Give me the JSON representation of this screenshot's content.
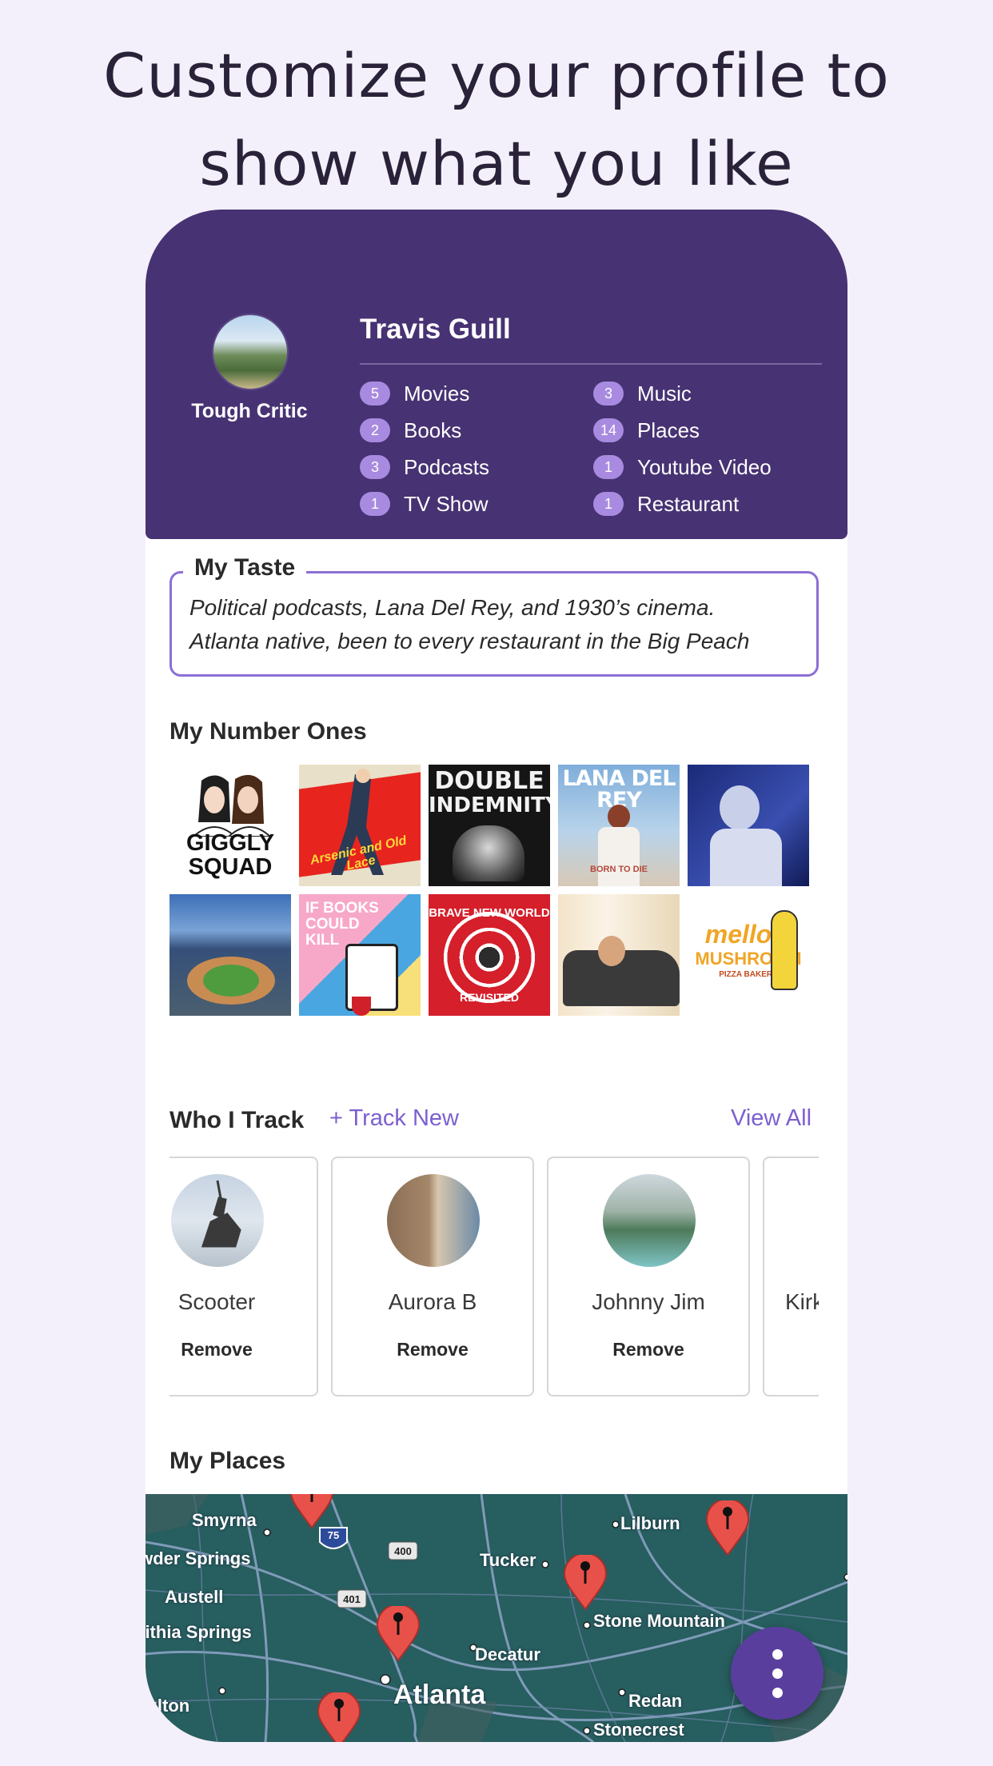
{
  "headline": {
    "line1": "Customize your profile to",
    "line2": "show what you like"
  },
  "profile": {
    "name": "Travis Guill",
    "level": "Tough Critic",
    "stats": [
      {
        "count": "5",
        "label": "Movies"
      },
      {
        "count": "3",
        "label": "Music"
      },
      {
        "count": "2",
        "label": "Books"
      },
      {
        "count": "14",
        "label": "Places"
      },
      {
        "count": "3",
        "label": "Podcasts"
      },
      {
        "count": "1",
        "label": "Youtube Video"
      },
      {
        "count": "1",
        "label": "TV Show"
      },
      {
        "count": "1",
        "label": "Restaurant"
      }
    ]
  },
  "taste": {
    "title": "My Taste",
    "line1": "Political podcasts, Lana Del Rey, and 1930’s cinema.",
    "line2": "Atlanta native, been to every restaurant in the Big Peach"
  },
  "number_ones": {
    "title": "My Number Ones",
    "tiles": [
      {
        "art": [
          "GIGGLY",
          "SQUAD"
        ]
      },
      {
        "art": [
          "Arsenic and Old Lace"
        ]
      },
      {
        "art": [
          "DOUBLE",
          "INDEMNITY"
        ]
      },
      {
        "art": [
          "LANA DEL REY",
          "BORN TO DIE"
        ]
      },
      {
        "art": []
      },
      {
        "art": []
      },
      {
        "art": [
          "IF BOOKS",
          "COULD",
          "KILL"
        ]
      },
      {
        "art": [
          "BRAVE NEW WORLD",
          "REVISITED"
        ]
      },
      {
        "art": []
      },
      {
        "art": [
          "mellow",
          "MUSHROOM",
          "PIZZA BAKERS"
        ]
      }
    ]
  },
  "tracking": {
    "title": "Who I Track",
    "track_new": "+ Track New",
    "view_all": "View All",
    "people": [
      {
        "name": "Scooter",
        "action": "Remove"
      },
      {
        "name": "Aurora B",
        "action": "Remove"
      },
      {
        "name": "Johnny Jim",
        "action": "Remove"
      },
      {
        "name": "Kirk"
      }
    ]
  },
  "places": {
    "title": "My Places",
    "map_labels": [
      "Smyrna",
      "Lilburn",
      "Powder Springs",
      "Tucker",
      "Austell",
      "Stone Mountain",
      "Lithia Springs",
      "Decatur",
      "Redan",
      "Fulton",
      "Atlanta",
      "Stonecrest"
    ],
    "shields": [
      "75",
      "400",
      "401"
    ]
  },
  "fab": {
    "icon": "more-vertical-icon"
  },
  "colors": {
    "header": "#473273",
    "accent": "#7c5fd0",
    "badge": "#a88be0",
    "background": "#f4f0fb"
  }
}
